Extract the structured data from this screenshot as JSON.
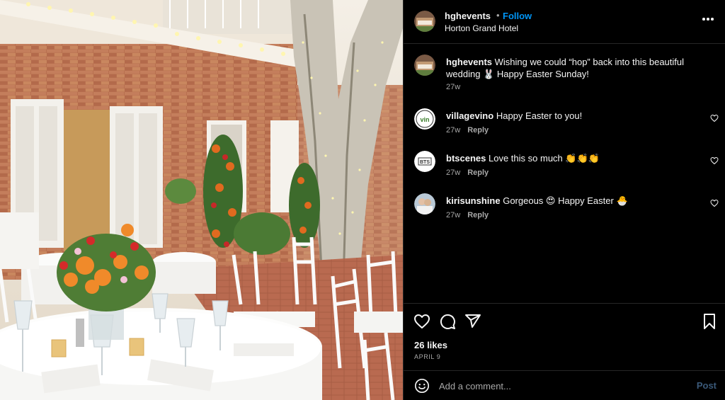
{
  "post": {
    "username": "hghevents",
    "follow_label": "Follow",
    "separator": "•",
    "location": "Horton Grand Hotel",
    "more_icon": "more-horizontal-icon"
  },
  "comments": [
    {
      "username": "hghevents",
      "text": "Wishing we could “hop” back into this beautiful wedding 🐰 Happy Easter Sunday!",
      "time": "27w",
      "reply_label": "",
      "avatar": "venue-photo"
    },
    {
      "username": "villagevino",
      "text": "Happy Easter to you!",
      "time": "27w",
      "reply_label": "Reply",
      "avatar": "vino-logo"
    },
    {
      "username": "btscenes",
      "text": "Love this so much 👏👏👏",
      "time": "27w",
      "reply_label": "Reply",
      "avatar": "bts-logo"
    },
    {
      "username": "kirisunshine",
      "text": "Gorgeous 😍 Happy Easter 🐣",
      "time": "27w",
      "reply_label": "Reply",
      "avatar": "couple-photo"
    }
  ],
  "actions": {
    "icons": [
      "heart-icon",
      "comment-icon",
      "share-icon",
      "bookmark-icon"
    ],
    "likes": "26 likes",
    "date": "APRIL 9"
  },
  "composer": {
    "placeholder": "Add a comment...",
    "post_label": "Post",
    "emoji_icon": "emoji-icon"
  },
  "colors": {
    "background": "#000000",
    "text": "#f5f5f5",
    "secondary_text": "#a8a8a8",
    "follow_blue": "#0095f6",
    "post_disabled": "#3b5a7a",
    "divider": "#262626"
  }
}
